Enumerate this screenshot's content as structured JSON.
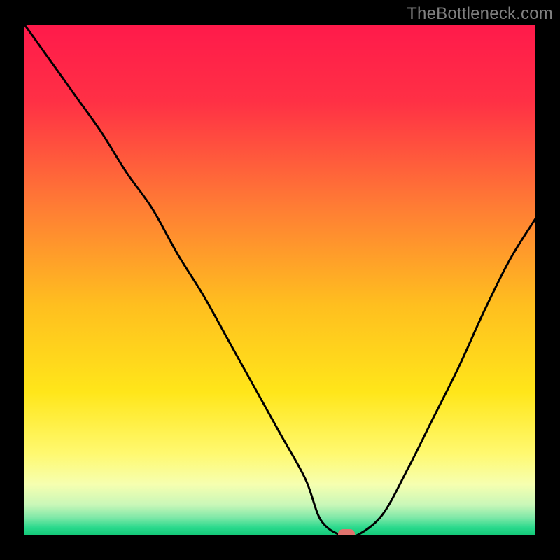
{
  "watermark": "TheBottleneck.com",
  "chart_data": {
    "type": "line",
    "title": "",
    "xlabel": "",
    "ylabel": "",
    "xlim": [
      0,
      100
    ],
    "ylim": [
      0,
      100
    ],
    "x": [
      0,
      5,
      10,
      15,
      20,
      25,
      30,
      35,
      40,
      45,
      50,
      55,
      58,
      62,
      65,
      70,
      75,
      80,
      85,
      90,
      95,
      100
    ],
    "values": [
      100,
      93,
      86,
      79,
      71,
      64,
      55,
      47,
      38,
      29,
      20,
      11,
      3,
      0,
      0,
      4,
      13,
      23,
      33,
      44,
      54,
      62
    ],
    "min_marker": {
      "x": 63,
      "y": 0
    },
    "gradient_stops": [
      {
        "pos": 0.0,
        "color": "#ff1a4b"
      },
      {
        "pos": 0.15,
        "color": "#ff3045"
      },
      {
        "pos": 0.35,
        "color": "#ff7a35"
      },
      {
        "pos": 0.55,
        "color": "#ffbf1f"
      },
      {
        "pos": 0.72,
        "color": "#ffe61a"
      },
      {
        "pos": 0.84,
        "color": "#fff970"
      },
      {
        "pos": 0.9,
        "color": "#f6ffb0"
      },
      {
        "pos": 0.94,
        "color": "#c9f7b8"
      },
      {
        "pos": 0.965,
        "color": "#7fe8a8"
      },
      {
        "pos": 0.985,
        "color": "#29d98c"
      },
      {
        "pos": 1.0,
        "color": "#12c877"
      }
    ]
  }
}
